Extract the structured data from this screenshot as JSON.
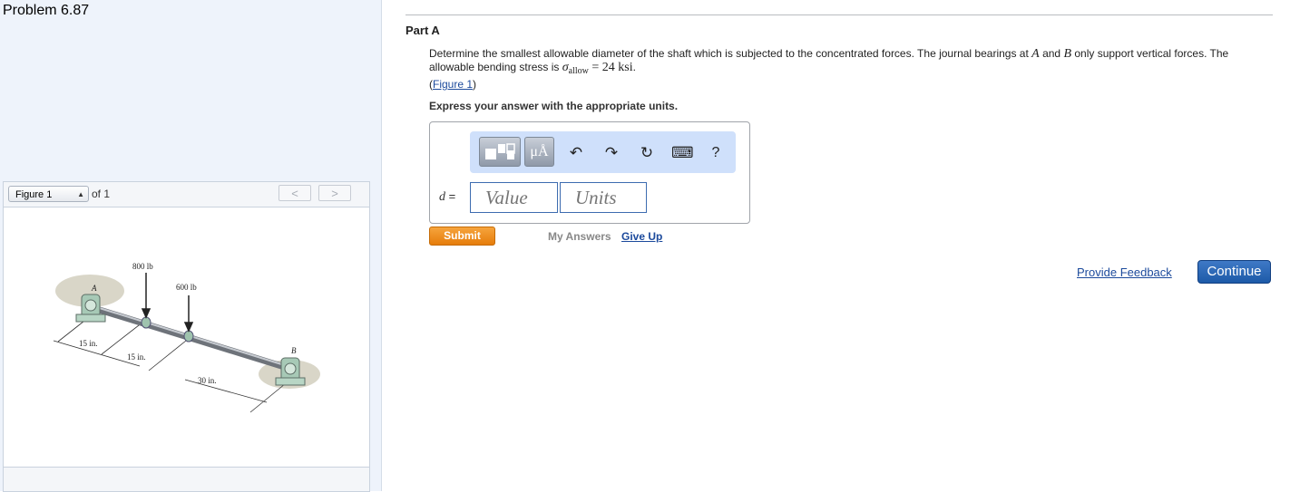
{
  "problem": {
    "title": "Problem 6.87"
  },
  "figure_panel": {
    "select_value": "Figure 1",
    "of_text": "of 1",
    "prev_label": "<",
    "next_label": ">",
    "labels": {
      "force1": "800 lb",
      "force2": "600 lb",
      "point_a": "A",
      "point_b": "B",
      "dim1": "15 in.",
      "dim2": "15 in.",
      "dim3": "30 in."
    }
  },
  "part": {
    "title": "Part A",
    "text_1": "Determine the smallest allowable diameter of the shaft which is subjected to the concentrated forces. The journal bearings at",
    "sym_a": "A",
    "text_and": "and",
    "sym_b": "B",
    "text_2": "only support vertical forces. The allowable bending stress is",
    "sigma": "σ",
    "sigma_sub": "allow",
    "equals_value": "= 24 ksi",
    "period": ".",
    "figure_link_open": "(",
    "figure_link": "Figure 1",
    "figure_link_close": ")",
    "instruction": "Express your answer with the appropriate units."
  },
  "answer": {
    "variable": "d",
    "equals": "=",
    "value_placeholder": "Value",
    "units_placeholder": "Units",
    "toolbar": {
      "units_label": "μÅ",
      "undo_glyph": "↶",
      "redo_glyph": "↷",
      "reset_glyph": "↻",
      "keyboard_glyph": "⌨",
      "help_label": "?"
    }
  },
  "actions": {
    "submit": "Submit",
    "my_answers": "My Answers",
    "give_up": "Give Up",
    "provide_feedback": "Provide Feedback",
    "continue": "Continue"
  },
  "colors": {
    "left_pane_bg": "#eef3fb",
    "link": "#1c4a9c",
    "submit": "#f08c1a",
    "continue": "#2a66b5",
    "toolbar_bg": "#cfe0fb"
  }
}
